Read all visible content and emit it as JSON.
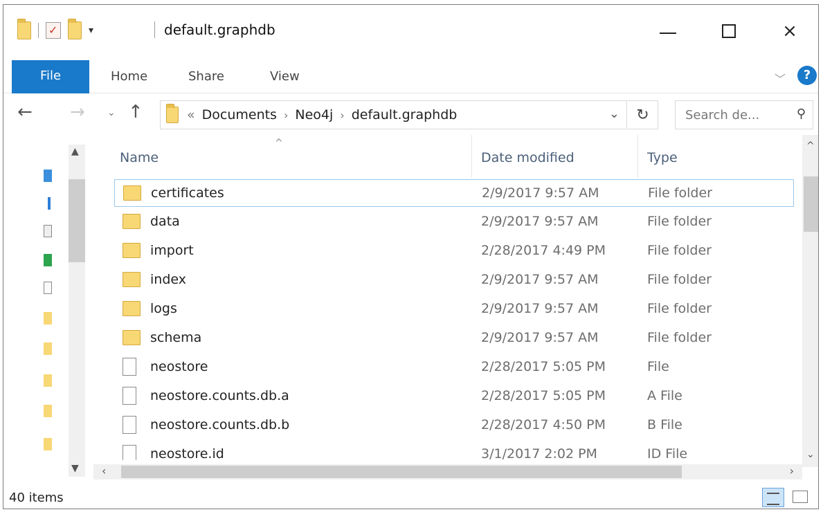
{
  "window": {
    "title": "default.graphdb",
    "minimize_label": "",
    "maximize_label": "",
    "close_label": "×"
  },
  "ribbon": {
    "tabs": [
      {
        "label": "File"
      },
      {
        "label": "Home"
      },
      {
        "label": "Share"
      },
      {
        "label": "View"
      }
    ],
    "help_label": "?"
  },
  "navigation": {
    "breadcrumbs": [
      "Documents",
      "Neo4j",
      "default.graphdb"
    ],
    "overflow_label": "«",
    "search_placeholder": "Search de..."
  },
  "columns": {
    "name": "Name",
    "date_modified": "Date modified",
    "type": "Type"
  },
  "files": [
    {
      "name": "certificates",
      "date": "2/9/2017 9:57 AM",
      "type": "File folder",
      "kind": "folder",
      "selected": true
    },
    {
      "name": "data",
      "date": "2/9/2017 9:57 AM",
      "type": "File folder",
      "kind": "folder"
    },
    {
      "name": "import",
      "date": "2/28/2017 4:49 PM",
      "type": "File folder",
      "kind": "folder"
    },
    {
      "name": "index",
      "date": "2/9/2017 9:57 AM",
      "type": "File folder",
      "kind": "folder"
    },
    {
      "name": "logs",
      "date": "2/9/2017 9:57 AM",
      "type": "File folder",
      "kind": "folder"
    },
    {
      "name": "schema",
      "date": "2/9/2017 9:57 AM",
      "type": "File folder",
      "kind": "folder"
    },
    {
      "name": "neostore",
      "date": "2/28/2017 5:05 PM",
      "type": "File",
      "kind": "file"
    },
    {
      "name": "neostore.counts.db.a",
      "date": "2/28/2017 5:05 PM",
      "type": "A File",
      "kind": "file"
    },
    {
      "name": "neostore.counts.db.b",
      "date": "2/28/2017 4:50 PM",
      "type": "B File",
      "kind": "file"
    },
    {
      "name": "neostore.id",
      "date": "3/1/2017 2:02 PM",
      "type": "ID File",
      "kind": "file"
    }
  ],
  "status": {
    "item_count": "40 items"
  },
  "colors": {
    "accent": "#1979ca",
    "folder": "#f8d775",
    "selection_border": "#99c9ef",
    "header_text": "#4c607a"
  },
  "icons": {
    "folder": "folder-icon",
    "file": "file-icon",
    "search": "search-icon",
    "refresh": "refresh-icon",
    "help": "help-icon"
  }
}
